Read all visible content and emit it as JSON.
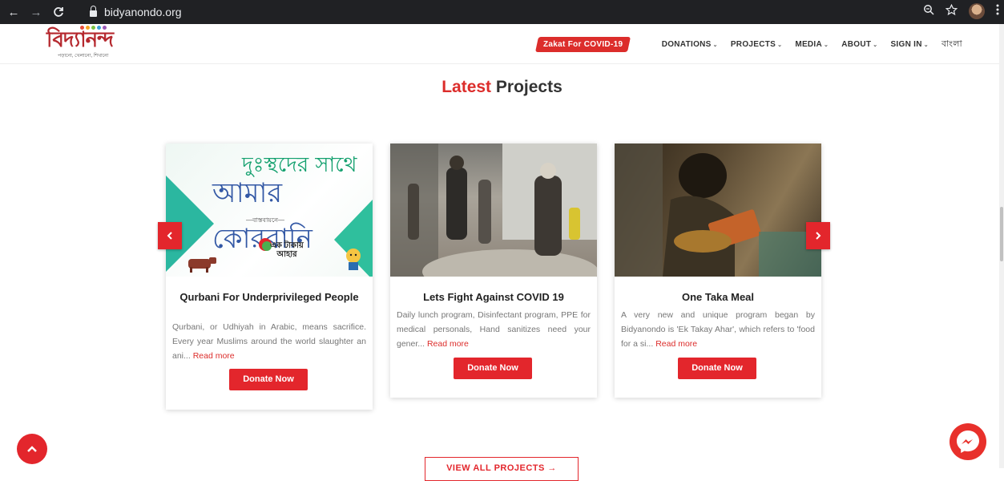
{
  "browser": {
    "url": "bidyanondo.org",
    "back_glyph": "←",
    "forward_glyph": "→",
    "reload_glyph": "C"
  },
  "header": {
    "logo_text": "বিদ্যানন্দ",
    "logo_tagline": "পড়ানো, খেলানো, শিখানো",
    "zakat_label": "Zakat For COVID-19",
    "nav": [
      {
        "label": "DONATIONS"
      },
      {
        "label": "PROJECTS"
      },
      {
        "label": "MEDIA"
      },
      {
        "label": "ABOUT"
      },
      {
        "label": "SIGN IN"
      }
    ],
    "language_label": "বাংলা"
  },
  "section": {
    "title_accent": "Latest",
    "title_rest": " Projects"
  },
  "cards": [
    {
      "title": "Qurbani For Underprivileged People",
      "desc": "Qurbani, or Udhiyah in Arabic, means sacrifice. Every year Muslims around the world slaughter an ani...",
      "read_more": "Read more",
      "donate": "Donate Now",
      "img_text1": "দুঃস্থদের সাথে",
      "img_text2": "আমার কোরবানি",
      "img_text3": "—বাস্তবায়নে—",
      "img_logo_text": "এক টাকায় আহার"
    },
    {
      "title": "Lets Fight Against COVID 19",
      "desc": "Daily lunch program, Disinfectant program, PPE for medical personals, Hand sanitizes need your gener...",
      "read_more": "Read more",
      "donate": "Donate Now"
    },
    {
      "title": "One Taka Meal",
      "desc": "A very new and unique program began by Bidyanondo is 'Ek Takay Ahar', which refers to 'food for a si...",
      "read_more": "Read more",
      "donate": "Donate Now"
    }
  ],
  "view_all": "VIEW ALL PROJECTS →",
  "colors": {
    "accent": "#e3262c",
    "browser_bar": "#202124"
  }
}
